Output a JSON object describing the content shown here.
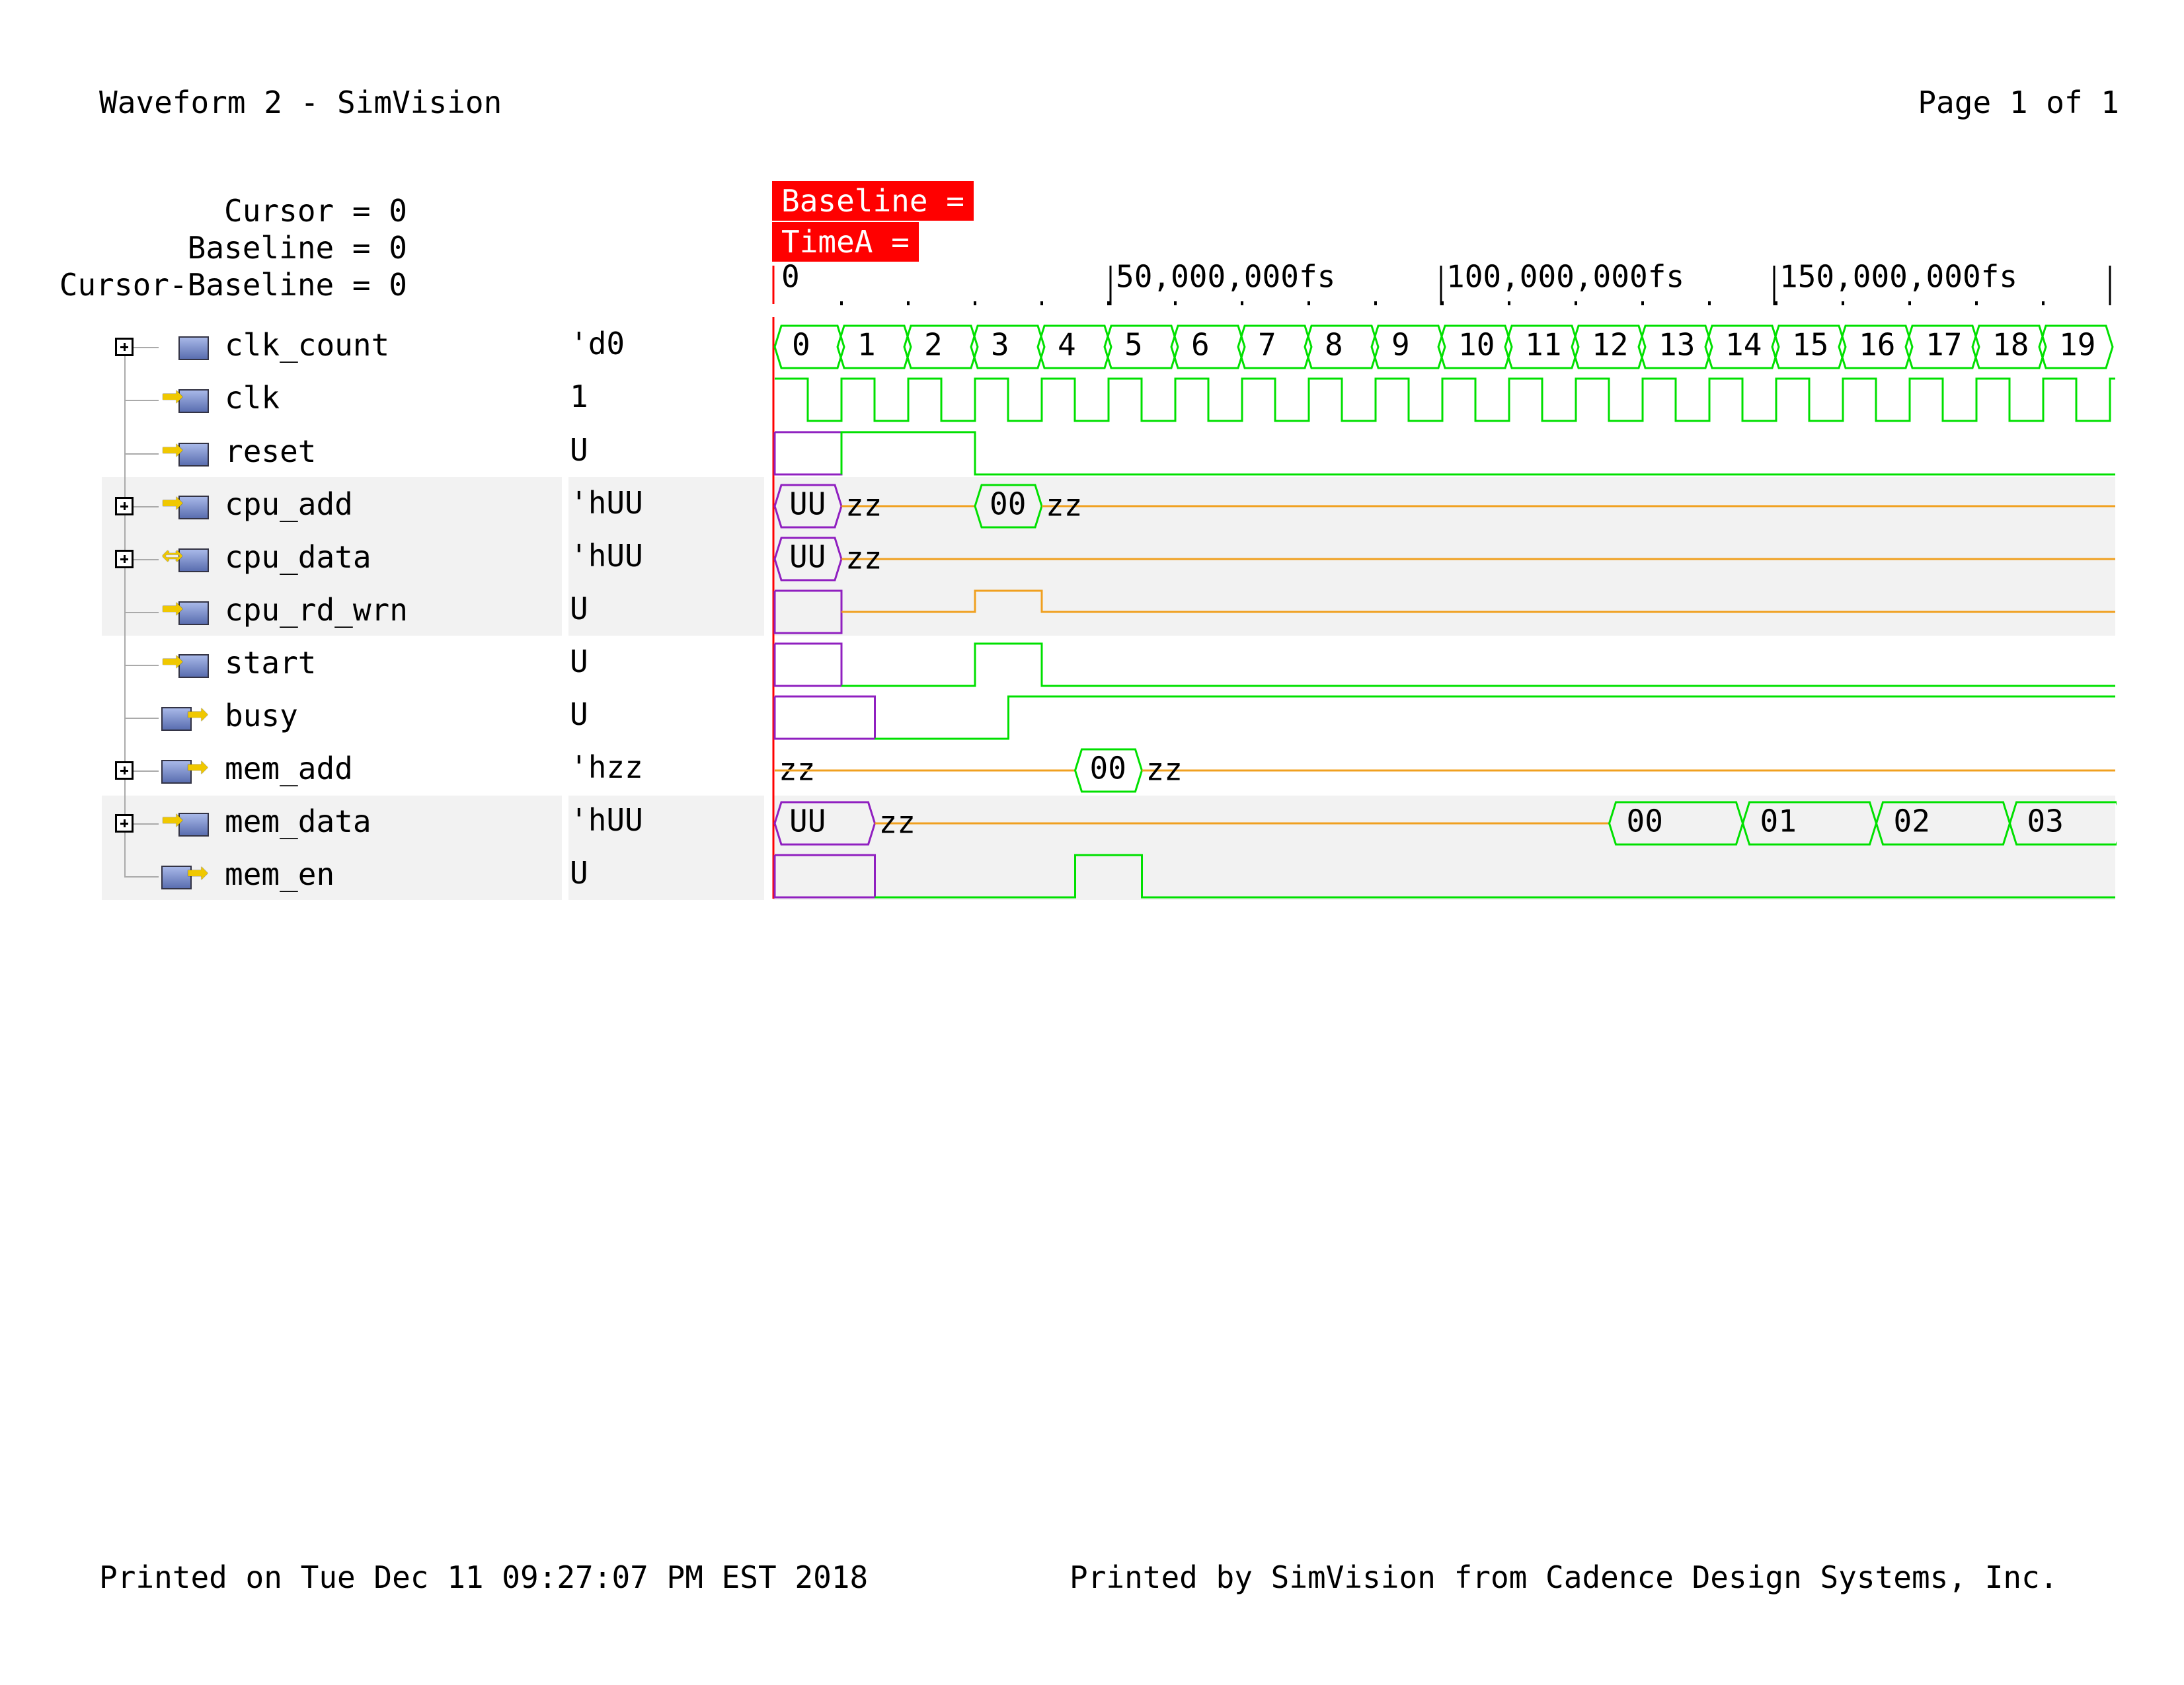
{
  "page": {
    "title": "Waveform 2 - SimVision",
    "page_number": "Page 1 of 1",
    "footer_left": "Printed on Tue Dec 11 09:27:07 PM EST 2018",
    "footer_right": "Printed by SimVision from Cadence Design Systems, Inc."
  },
  "cursor_info": {
    "cursor": "Cursor = 0",
    "baseline": "Baseline = 0",
    "cursor_minus_baseline": "Cursor-Baseline = 0"
  },
  "markers": {
    "baseline": "Baseline =",
    "timea": "TimeA ="
  },
  "timeline": {
    "start_label": "0",
    "ticks": [
      "50,000,000fs",
      "100,000,000fs",
      "150,000,000fs"
    ]
  },
  "colors": {
    "signal": "#00e000",
    "bus_z": "#f0a020",
    "unknown": "#9020c0",
    "cursor": "#ff0000",
    "row_shade": "#f2f2f2"
  },
  "signals": [
    {
      "name": "clk_count",
      "value": "'d0",
      "icon": "bus-register-icon",
      "expandable": true,
      "shaded": false
    },
    {
      "name": "clk",
      "value": "1",
      "icon": "input-port-icon",
      "expandable": false,
      "shaded": false
    },
    {
      "name": "reset",
      "value": "U",
      "icon": "input-port-icon",
      "expandable": false,
      "shaded": false
    },
    {
      "name": "cpu_add",
      "value": "'hUU",
      "icon": "input-bus-icon",
      "expandable": true,
      "shaded": true
    },
    {
      "name": "cpu_data",
      "value": "'hUU",
      "icon": "inout-bus-icon",
      "expandable": true,
      "shaded": true
    },
    {
      "name": "cpu_rd_wrn",
      "value": "U",
      "icon": "input-port-icon",
      "expandable": false,
      "shaded": true
    },
    {
      "name": "start",
      "value": "U",
      "icon": "input-port-icon",
      "expandable": false,
      "shaded": false
    },
    {
      "name": "busy",
      "value": "U",
      "icon": "output-port-icon",
      "expandable": false,
      "shaded": false
    },
    {
      "name": "mem_add",
      "value": "'hzz",
      "icon": "output-bus-icon",
      "expandable": true,
      "shaded": false
    },
    {
      "name": "mem_data",
      "value": "'hUU",
      "icon": "input-bus-icon",
      "expandable": true,
      "shaded": true
    },
    {
      "name": "mem_en",
      "value": "U",
      "icon": "output-port-icon",
      "expandable": false,
      "shaded": true
    }
  ],
  "waveforms": {
    "clk_count_labels": [
      "0",
      "1",
      "2",
      "3",
      "4",
      "5",
      "6",
      "7",
      "8",
      "9",
      "10",
      "11",
      "12",
      "13",
      "14",
      "15",
      "16",
      "17",
      "18",
      "19"
    ],
    "cpu_add_labels": [
      "UU",
      "zz",
      "00",
      "zz"
    ],
    "cpu_data_labels": [
      "UU",
      "zz"
    ],
    "mem_add_labels": [
      "zz",
      "00",
      "zz"
    ],
    "mem_data_labels": [
      "UU",
      "zz",
      "00",
      "01",
      "02",
      "03"
    ]
  }
}
